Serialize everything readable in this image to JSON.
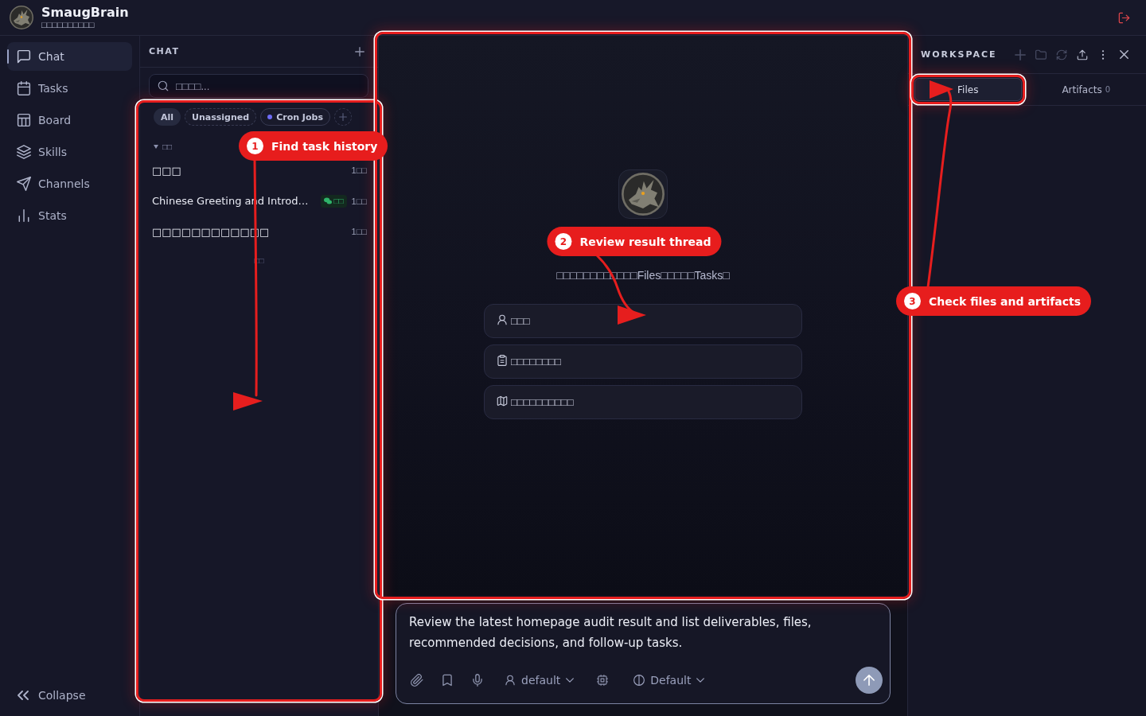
{
  "app": {
    "name": "SmaugBrain",
    "subtitle": "□□□□□□□□□□"
  },
  "sidebar": {
    "items": [
      {
        "label": "Chat",
        "selected": true
      },
      {
        "label": "Tasks",
        "selected": false
      },
      {
        "label": "Board",
        "selected": false
      },
      {
        "label": "Skills",
        "selected": false
      },
      {
        "label": "Channels",
        "selected": false
      },
      {
        "label": "Stats",
        "selected": false
      }
    ],
    "collapse_label": "Collapse"
  },
  "chat_panel": {
    "title": "CHAT",
    "search": {
      "placeholder": "□□□□..."
    },
    "filters": [
      {
        "label": "All",
        "kind": "plain",
        "selected": true
      },
      {
        "label": "Unassigned",
        "kind": "dashed",
        "selected": false
      },
      {
        "label": "Cron Jobs",
        "kind": "dot",
        "selected": false
      }
    ],
    "group": {
      "label": "□□",
      "expanded": true,
      "sessions": [
        {
          "title": "□□□",
          "time": "1□□"
        },
        {
          "title": "Chinese Greeting and Introd…",
          "badge": "□□",
          "time": "1□□"
        },
        {
          "title": "□□□□□□□□□□□□",
          "time": "1□□"
        }
      ]
    },
    "list_hint": "□□"
  },
  "thread": {
    "greeting": "□□□□□□□□□□□□Files□□□□□Tasks□",
    "suggestions": [
      {
        "label": "□□□"
      },
      {
        "label": "□□□□□□□□"
      },
      {
        "label": "□□□□□□□□□□"
      }
    ]
  },
  "composer": {
    "value": "Review the latest homepage audit result and list deliverables, files, recommended decisions, and follow-up tasks.",
    "agent": "default",
    "model": "Default"
  },
  "workspace": {
    "title": "WORKSPACE",
    "toolbar": [
      {
        "disabled": true
      },
      {
        "disabled": true
      },
      {
        "disabled": true
      },
      {
        "disabled": false
      },
      {
        "disabled": false
      },
      {
        "disabled": false
      }
    ],
    "tabs": [
      {
        "label": "Files",
        "selected": true
      },
      {
        "label": "Artifacts",
        "count": "0",
        "selected": false
      }
    ]
  },
  "annotations": [
    {
      "number": "1",
      "label": "Find task history"
    },
    {
      "number": "2",
      "label": "Review result thread"
    },
    {
      "number": "3",
      "label": "Check files and artifacts"
    }
  ]
}
